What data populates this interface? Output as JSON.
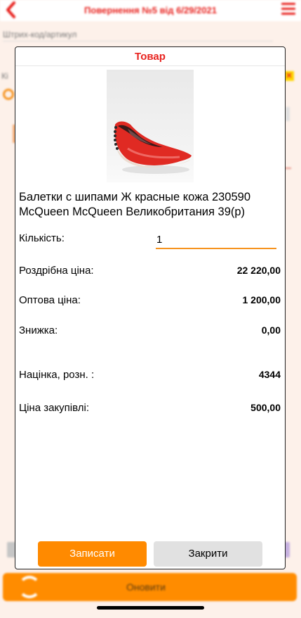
{
  "background": {
    "header_title": "Повернення №5 від 6/29/2021",
    "barcode_label": "Штрих-код/артикул",
    "ki_label": "Кі",
    "refresh_label": "Оновити"
  },
  "modal": {
    "title": "Товар",
    "product_name": "Балетки с шипами Ж красные кожа 230590 McQueen McQueen Великобритания 39(р)",
    "quantity": {
      "label": "Кількість:",
      "value": "1"
    },
    "rows": [
      {
        "label": "Роздрібна ціна:",
        "value": "22 220,00"
      },
      {
        "label": "Оптова ціна:",
        "value": "1 200,00"
      },
      {
        "label": "Знижка:",
        "value": "0,00"
      },
      {
        "label": "Націнка, розн. :",
        "value": "4344"
      },
      {
        "label": "Ціна закупівлі:",
        "value": "500,00"
      }
    ],
    "save_button": "Записати",
    "close_button": "Закрити"
  },
  "colors": {
    "accent_red": "#e8231f",
    "accent_orange": "#ff8a00",
    "product_red": "#e02a23"
  },
  "icons": [
    "back-arrow-icon",
    "hamburger-menu-icon",
    "search-icon",
    "refresh-icon"
  ]
}
